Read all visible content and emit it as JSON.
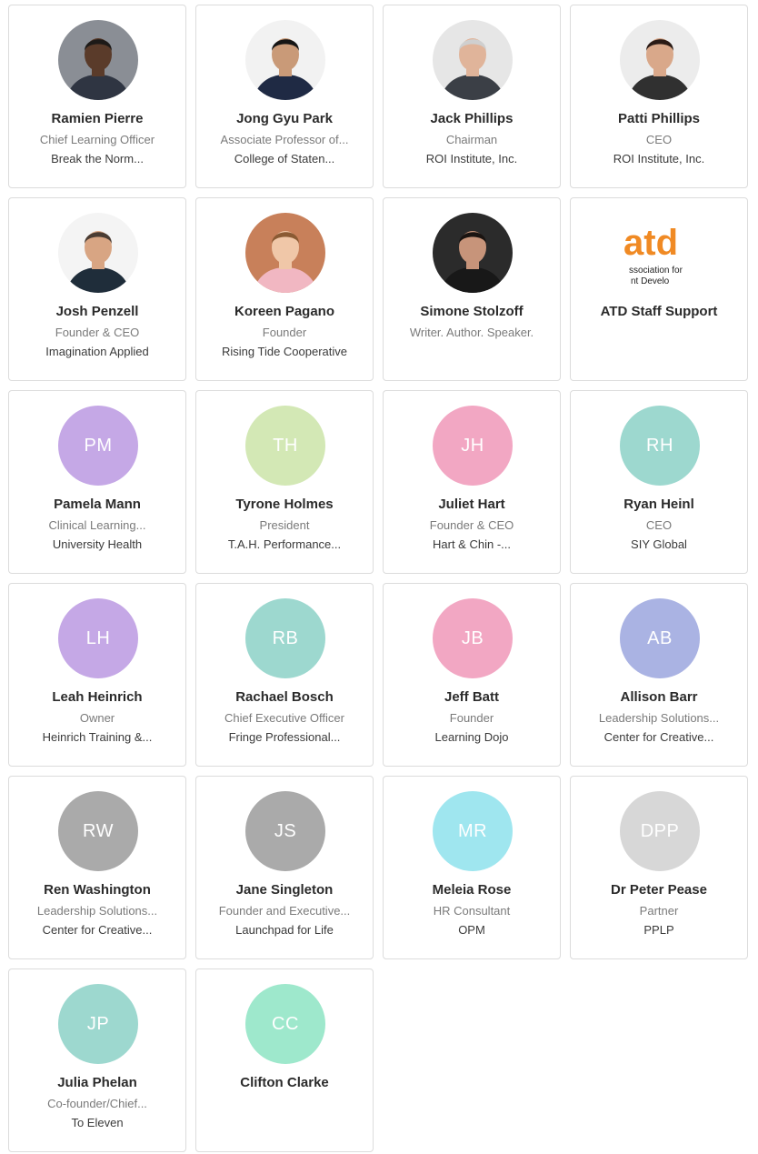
{
  "people": [
    {
      "name": "Ramien Pierre",
      "title": "Chief Learning Officer",
      "org": "Break the Norm...",
      "photo": true,
      "avatar_kind": "photo",
      "bg": "#8a8e95",
      "skin": "#5a3b2a",
      "hair": "#1d1a18",
      "shirt": "#2f3542"
    },
    {
      "name": "Jong Gyu Park",
      "title": "Associate Professor of...",
      "org": "College of Staten...",
      "photo": true,
      "avatar_kind": "photo",
      "bg": "#f2f2f2",
      "skin": "#c99a78",
      "hair": "#151515",
      "shirt": "#1f2a44"
    },
    {
      "name": "Jack Phillips",
      "title": "Chairman",
      "org": "ROI Institute, Inc.",
      "photo": true,
      "avatar_kind": "photo",
      "bg": "#e6e6e6",
      "skin": "#e0b49a",
      "hair": "#cfcfcf",
      "shirt": "#3b3f46"
    },
    {
      "name": "Patti Phillips",
      "title": "CEO",
      "org": "ROI Institute, Inc.",
      "photo": true,
      "avatar_kind": "photo",
      "bg": "#ececec",
      "skin": "#d9a88a",
      "hair": "#2a1b16",
      "shirt": "#303030"
    },
    {
      "name": "Josh Penzell",
      "title": "Founder & CEO",
      "org": "Imagination Applied",
      "photo": true,
      "avatar_kind": "photo",
      "bg": "#f4f4f4",
      "skin": "#d8a583",
      "hair": "#4a3c33",
      "shirt": "#1f2d3a"
    },
    {
      "name": "Koreen Pagano",
      "title": "Founder",
      "org": "Rising Tide Cooperative",
      "photo": true,
      "avatar_kind": "photo",
      "bg": "#c8805a",
      "skin": "#f0c7a8",
      "hair": "#8a5a33",
      "shirt": "#f1b7c2"
    },
    {
      "name": "Simone Stolzoff",
      "title": "Writer. Author. Speaker.",
      "org": "",
      "photo": true,
      "avatar_kind": "photo",
      "bg": "#2b2b2b",
      "skin": "#c7947a",
      "hair": "#1a1411",
      "shirt": "#181818"
    },
    {
      "name": "ATD Staff Support",
      "title": "",
      "org": "",
      "photo": false,
      "avatar_kind": "logo",
      "bg": "#ffffff",
      "logo_text": "atd",
      "logo_sub1": "ssociation for",
      "logo_sub2": "nt Develo"
    },
    {
      "name": "Pamela Mann",
      "title": "Clinical Learning...",
      "org": "University Health",
      "initials": "PM",
      "avatar_kind": "initials",
      "bg": "#c5a8e6"
    },
    {
      "name": "Tyrone Holmes",
      "title": "President",
      "org": "T.A.H. Performance...",
      "initials": "TH",
      "avatar_kind": "initials",
      "bg": "#d3e8b5"
    },
    {
      "name": "Juliet Hart",
      "title": "Founder & CEO",
      "org": "Hart & Chin -...",
      "initials": "JH",
      "avatar_kind": "initials",
      "bg": "#f2a7c3"
    },
    {
      "name": "Ryan Heinl",
      "title": "CEO",
      "org": "SIY Global",
      "initials": "RH",
      "avatar_kind": "initials",
      "bg": "#9dd8cf"
    },
    {
      "name": "Leah Heinrich",
      "title": "Owner",
      "org": "Heinrich Training &...",
      "initials": "LH",
      "avatar_kind": "initials",
      "bg": "#c5a8e6"
    },
    {
      "name": "Rachael Bosch",
      "title": "Chief Executive Officer",
      "org": "Fringe Professional...",
      "initials": "RB",
      "avatar_kind": "initials",
      "bg": "#9dd8cf"
    },
    {
      "name": "Jeff Batt",
      "title": "Founder",
      "org": "Learning Dojo",
      "initials": "JB",
      "avatar_kind": "initials",
      "bg": "#f2a7c3"
    },
    {
      "name": "Allison Barr",
      "title": "Leadership Solutions...",
      "org": "Center for Creative...",
      "initials": "AB",
      "avatar_kind": "initials",
      "bg": "#aab3e3"
    },
    {
      "name": "Ren Washington",
      "title": "Leadership Solutions...",
      "org": "Center for Creative...",
      "initials": "RW",
      "avatar_kind": "initials",
      "bg": "#aaaaaa"
    },
    {
      "name": "Jane Singleton",
      "title": "Founder and Executive...",
      "org": "Launchpad for Life",
      "initials": "JS",
      "avatar_kind": "initials",
      "bg": "#aaaaaa"
    },
    {
      "name": "Meleia Rose",
      "title": "HR Consultant",
      "org": "OPM",
      "initials": "MR",
      "avatar_kind": "initials",
      "bg": "#9fe6ef"
    },
    {
      "name": "Dr Peter Pease",
      "title": "Partner",
      "org": "PPLP",
      "initials": "DPP",
      "avatar_kind": "initials",
      "bg": "#d7d7d7"
    },
    {
      "name": "Julia Phelan",
      "title": "Co-founder/Chief...",
      "org": "To Eleven",
      "initials": "JP",
      "avatar_kind": "initials",
      "bg": "#9dd8cf"
    },
    {
      "name": "Clifton Clarke",
      "title": "",
      "org": "",
      "initials": "CC",
      "avatar_kind": "initials",
      "bg": "#9ee8cc"
    }
  ],
  "colors": {
    "border": "#dcdcdc",
    "name": "#2b2b2b",
    "title": "#7a7a7a",
    "org": "#3a3a3a",
    "atd_orange": "#f08a24",
    "atd_red": "#d6202c"
  }
}
